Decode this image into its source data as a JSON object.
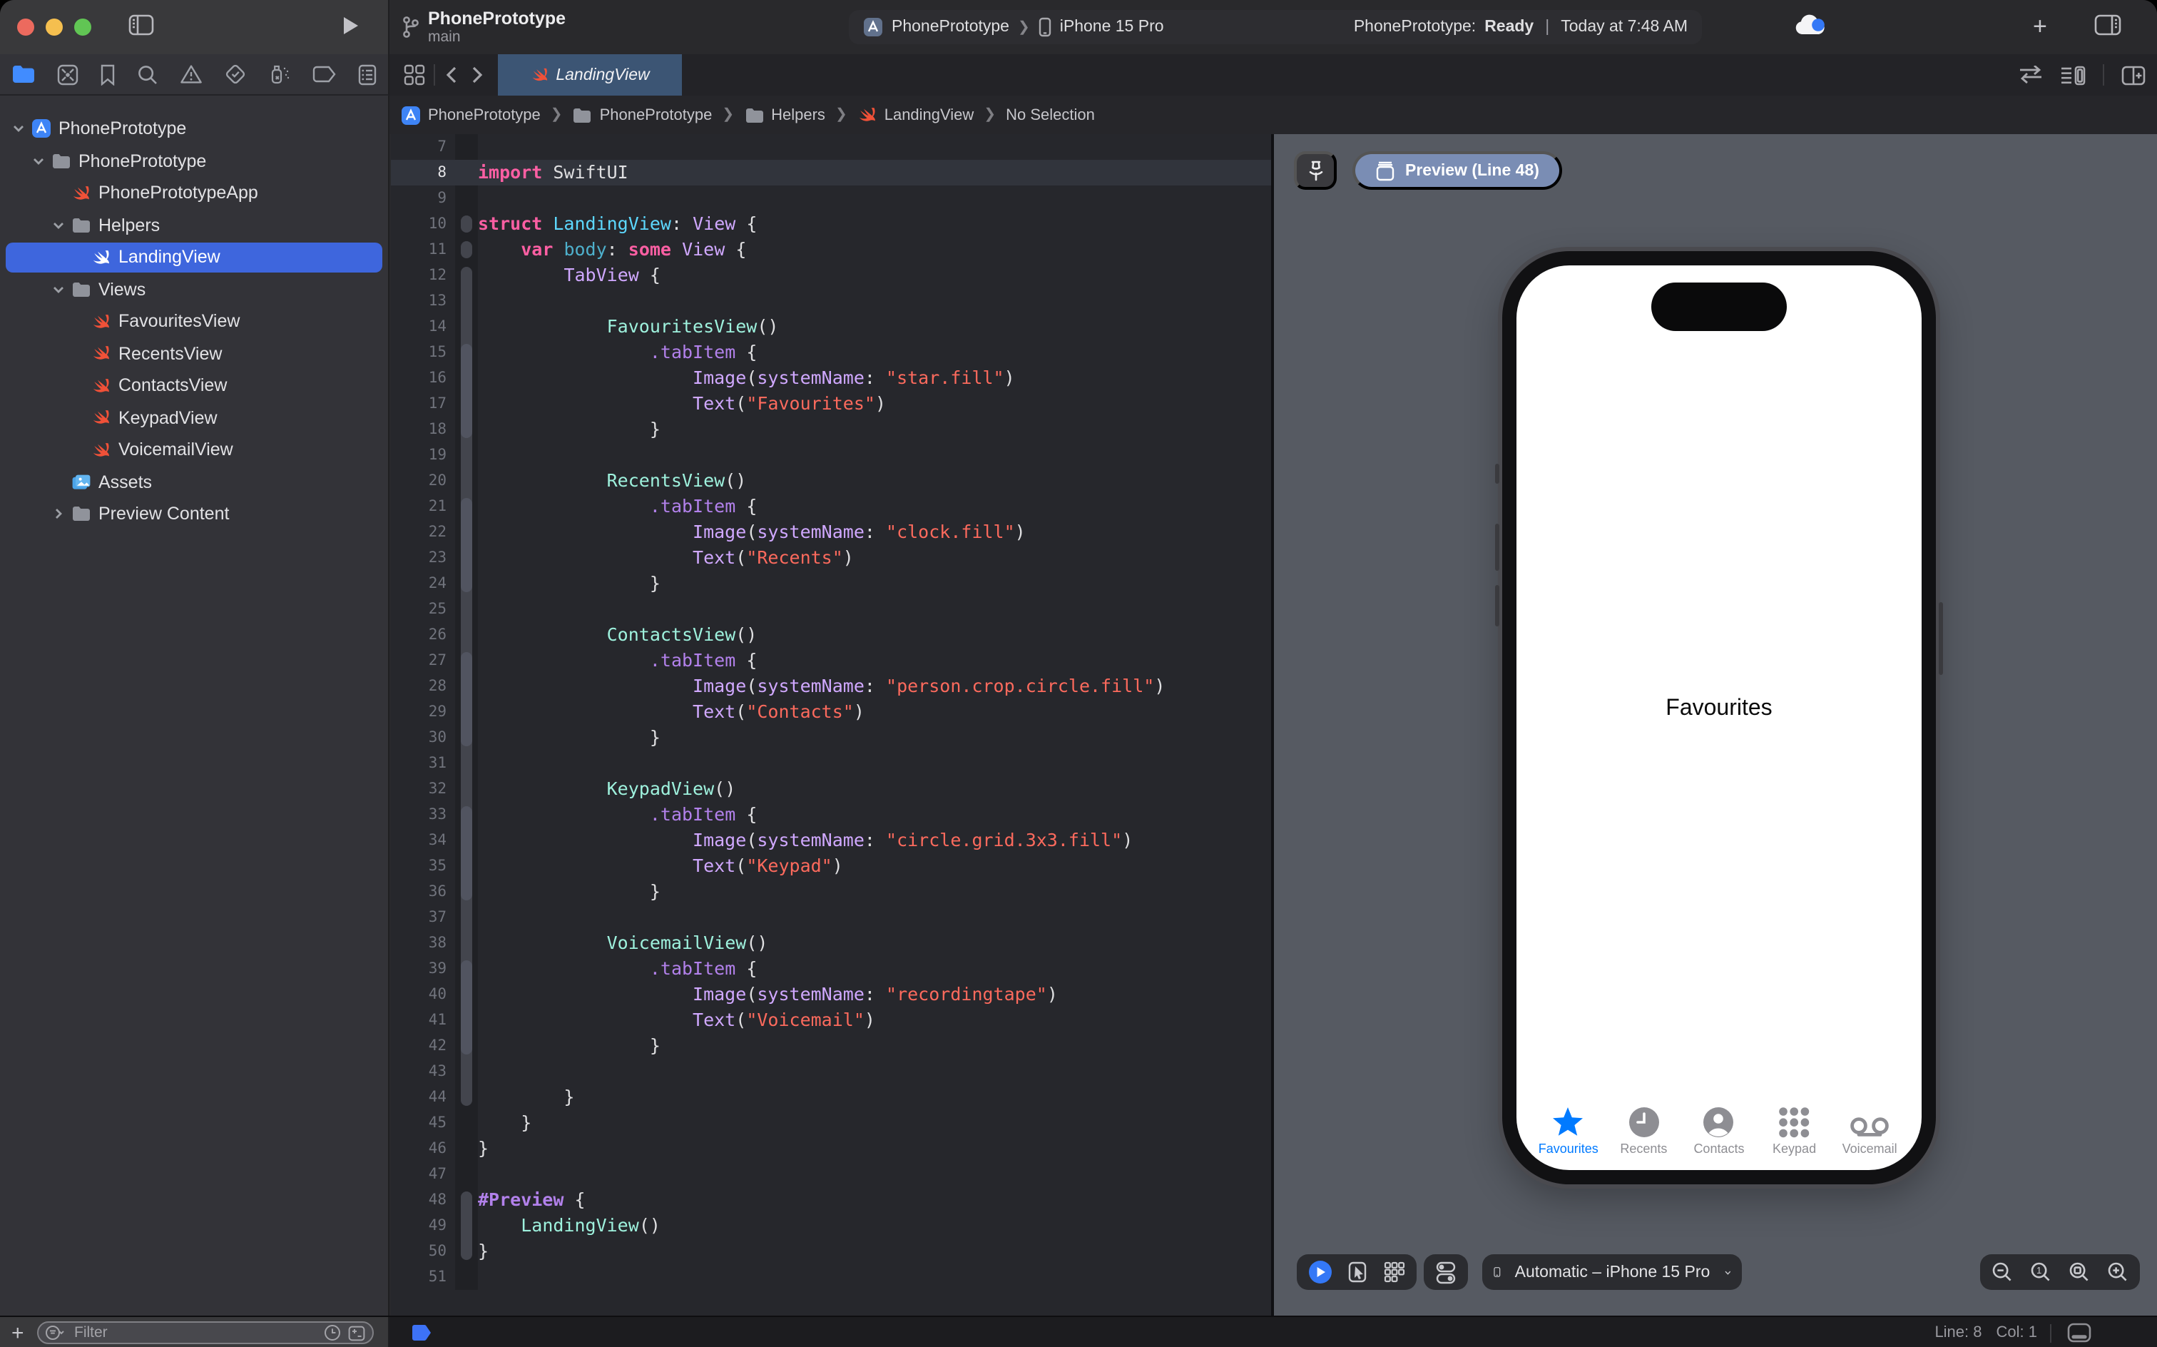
{
  "toolbar": {
    "window_title": "PhonePrototype",
    "branch": "main",
    "scheme": {
      "project": "PhonePrototype",
      "destination": "iPhone 15 Pro"
    },
    "status": {
      "project": "PhonePrototype:",
      "state": "Ready",
      "separator": "|",
      "time": "Today at 7:48 AM"
    },
    "add_label": "+"
  },
  "navigator": {
    "filter_placeholder": "Filter",
    "files": [
      {
        "label": "PhonePrototype",
        "depth": 0,
        "icon": "project",
        "disclosure": "open"
      },
      {
        "label": "PhonePrototype",
        "depth": 1,
        "icon": "folder",
        "disclosure": "open"
      },
      {
        "label": "PhonePrototypeApp",
        "depth": 2,
        "icon": "swift"
      },
      {
        "label": "Helpers",
        "depth": 2,
        "icon": "folder",
        "disclosure": "open"
      },
      {
        "label": "LandingView",
        "depth": 3,
        "icon": "swift",
        "selected": true
      },
      {
        "label": "Views",
        "depth": 2,
        "icon": "folder",
        "disclosure": "open"
      },
      {
        "label": "FavouritesView",
        "depth": 3,
        "icon": "swift"
      },
      {
        "label": "RecentsView",
        "depth": 3,
        "icon": "swift"
      },
      {
        "label": "ContactsView",
        "depth": 3,
        "icon": "swift"
      },
      {
        "label": "KeypadView",
        "depth": 3,
        "icon": "swift"
      },
      {
        "label": "VoicemailView",
        "depth": 3,
        "icon": "swift"
      },
      {
        "label": "Assets",
        "depth": 2,
        "icon": "assets"
      },
      {
        "label": "Preview Content",
        "depth": 2,
        "icon": "folder",
        "disclosure": "closed"
      }
    ]
  },
  "editor": {
    "tab_label": "LandingView",
    "breadcrumbs": [
      {
        "label": "PhonePrototype",
        "icon": "project"
      },
      {
        "label": "PhonePrototype",
        "icon": "folder"
      },
      {
        "label": "Helpers",
        "icon": "folder"
      },
      {
        "label": "LandingView",
        "icon": "swift"
      },
      {
        "label": "No Selection",
        "icon": "none"
      }
    ],
    "current_line": 8,
    "fold_ranges": [
      [
        10,
        10
      ],
      [
        11,
        11
      ],
      [
        12,
        44
      ],
      [
        48,
        50
      ]
    ],
    "fold_ranges_inner": [
      [
        15,
        18
      ],
      [
        21,
        24
      ],
      [
        27,
        30
      ],
      [
        33,
        36
      ],
      [
        39,
        42
      ]
    ],
    "lines": [
      {
        "n": 7,
        "t": []
      },
      {
        "n": 8,
        "t": [
          [
            "k",
            "import"
          ],
          [
            "p",
            " SwiftUI"
          ]
        ]
      },
      {
        "n": 9,
        "t": []
      },
      {
        "n": 10,
        "t": [
          [
            "k",
            "struct"
          ],
          [
            "p",
            " "
          ],
          [
            "td",
            "LandingView"
          ],
          [
            "p",
            ": "
          ],
          [
            "cl",
            "View"
          ],
          [
            "p",
            " {"
          ]
        ]
      },
      {
        "n": 11,
        "t": [
          [
            "p",
            "    "
          ],
          [
            "k",
            "var"
          ],
          [
            "p",
            " "
          ],
          [
            "pr",
            "body"
          ],
          [
            "p",
            ": "
          ],
          [
            "k",
            "some"
          ],
          [
            "p",
            " "
          ],
          [
            "cl",
            "View"
          ],
          [
            "p",
            " {"
          ]
        ]
      },
      {
        "n": 12,
        "t": [
          [
            "p",
            "        "
          ],
          [
            "cl",
            "TabView"
          ],
          [
            "p",
            " {"
          ]
        ]
      },
      {
        "n": 13,
        "t": []
      },
      {
        "n": 14,
        "t": [
          [
            "p",
            "            "
          ],
          [
            "pt",
            "FavouritesView"
          ],
          [
            "p",
            "()"
          ]
        ]
      },
      {
        "n": 15,
        "t": [
          [
            "p",
            "                "
          ],
          [
            "fn",
            ".tabItem"
          ],
          [
            "p",
            " {"
          ]
        ]
      },
      {
        "n": 16,
        "t": [
          [
            "p",
            "                    "
          ],
          [
            "cl",
            "Image"
          ],
          [
            "p",
            "("
          ],
          [
            "cl",
            "systemName"
          ],
          [
            "p",
            ": "
          ],
          [
            "s",
            "\"star.fill\""
          ],
          [
            "p",
            ")"
          ]
        ]
      },
      {
        "n": 17,
        "t": [
          [
            "p",
            "                    "
          ],
          [
            "cl",
            "Text"
          ],
          [
            "p",
            "("
          ],
          [
            "s",
            "\"Favourites\""
          ],
          [
            "p",
            ")"
          ]
        ]
      },
      {
        "n": 18,
        "t": [
          [
            "p",
            "                }"
          ]
        ]
      },
      {
        "n": 19,
        "t": []
      },
      {
        "n": 20,
        "t": [
          [
            "p",
            "            "
          ],
          [
            "pt",
            "RecentsView"
          ],
          [
            "p",
            "()"
          ]
        ]
      },
      {
        "n": 21,
        "t": [
          [
            "p",
            "                "
          ],
          [
            "fn",
            ".tabItem"
          ],
          [
            "p",
            " {"
          ]
        ]
      },
      {
        "n": 22,
        "t": [
          [
            "p",
            "                    "
          ],
          [
            "cl",
            "Image"
          ],
          [
            "p",
            "("
          ],
          [
            "cl",
            "systemName"
          ],
          [
            "p",
            ": "
          ],
          [
            "s",
            "\"clock.fill\""
          ],
          [
            "p",
            ")"
          ]
        ]
      },
      {
        "n": 23,
        "t": [
          [
            "p",
            "                    "
          ],
          [
            "cl",
            "Text"
          ],
          [
            "p",
            "("
          ],
          [
            "s",
            "\"Recents\""
          ],
          [
            "p",
            ")"
          ]
        ]
      },
      {
        "n": 24,
        "t": [
          [
            "p",
            "                }"
          ]
        ]
      },
      {
        "n": 25,
        "t": []
      },
      {
        "n": 26,
        "t": [
          [
            "p",
            "            "
          ],
          [
            "pt",
            "ContactsView"
          ],
          [
            "p",
            "()"
          ]
        ]
      },
      {
        "n": 27,
        "t": [
          [
            "p",
            "                "
          ],
          [
            "fn",
            ".tabItem"
          ],
          [
            "p",
            " {"
          ]
        ]
      },
      {
        "n": 28,
        "t": [
          [
            "p",
            "                    "
          ],
          [
            "cl",
            "Image"
          ],
          [
            "p",
            "("
          ],
          [
            "cl",
            "systemName"
          ],
          [
            "p",
            ": "
          ],
          [
            "s",
            "\"person.crop.circle.fill\""
          ],
          [
            "p",
            ")"
          ]
        ]
      },
      {
        "n": 29,
        "t": [
          [
            "p",
            "                    "
          ],
          [
            "cl",
            "Text"
          ],
          [
            "p",
            "("
          ],
          [
            "s",
            "\"Contacts\""
          ],
          [
            "p",
            ")"
          ]
        ]
      },
      {
        "n": 30,
        "t": [
          [
            "p",
            "                }"
          ]
        ]
      },
      {
        "n": 31,
        "t": []
      },
      {
        "n": 32,
        "t": [
          [
            "p",
            "            "
          ],
          [
            "pt",
            "KeypadView"
          ],
          [
            "p",
            "()"
          ]
        ]
      },
      {
        "n": 33,
        "t": [
          [
            "p",
            "                "
          ],
          [
            "fn",
            ".tabItem"
          ],
          [
            "p",
            " {"
          ]
        ]
      },
      {
        "n": 34,
        "t": [
          [
            "p",
            "                    "
          ],
          [
            "cl",
            "Image"
          ],
          [
            "p",
            "("
          ],
          [
            "cl",
            "systemName"
          ],
          [
            "p",
            ": "
          ],
          [
            "s",
            "\"circle.grid.3x3.fill\""
          ],
          [
            "p",
            ")"
          ]
        ]
      },
      {
        "n": 35,
        "t": [
          [
            "p",
            "                    "
          ],
          [
            "cl",
            "Text"
          ],
          [
            "p",
            "("
          ],
          [
            "s",
            "\"Keypad\""
          ],
          [
            "p",
            ")"
          ]
        ]
      },
      {
        "n": 36,
        "t": [
          [
            "p",
            "                }"
          ]
        ]
      },
      {
        "n": 37,
        "t": []
      },
      {
        "n": 38,
        "t": [
          [
            "p",
            "            "
          ],
          [
            "pt",
            "VoicemailView"
          ],
          [
            "p",
            "()"
          ]
        ]
      },
      {
        "n": 39,
        "t": [
          [
            "p",
            "                "
          ],
          [
            "fn",
            ".tabItem"
          ],
          [
            "p",
            " {"
          ]
        ]
      },
      {
        "n": 40,
        "t": [
          [
            "p",
            "                    "
          ],
          [
            "cl",
            "Image"
          ],
          [
            "p",
            "("
          ],
          [
            "cl",
            "systemName"
          ],
          [
            "p",
            ": "
          ],
          [
            "s",
            "\"recordingtape\""
          ],
          [
            "p",
            ")"
          ]
        ]
      },
      {
        "n": 41,
        "t": [
          [
            "p",
            "                    "
          ],
          [
            "cl",
            "Text"
          ],
          [
            "p",
            "("
          ],
          [
            "s",
            "\"Voicemail\""
          ],
          [
            "p",
            ")"
          ]
        ]
      },
      {
        "n": 42,
        "t": [
          [
            "p",
            "                }"
          ]
        ]
      },
      {
        "n": 43,
        "t": []
      },
      {
        "n": 44,
        "t": [
          [
            "p",
            "        }"
          ]
        ]
      },
      {
        "n": 45,
        "t": [
          [
            "p",
            "    }"
          ]
        ]
      },
      {
        "n": 46,
        "t": [
          [
            "p",
            "}"
          ]
        ]
      },
      {
        "n": 47,
        "t": []
      },
      {
        "n": 48,
        "t": [
          [
            "dr",
            "#Preview"
          ],
          [
            "p",
            " {"
          ]
        ]
      },
      {
        "n": 49,
        "t": [
          [
            "p",
            "    "
          ],
          [
            "pt",
            "LandingView"
          ],
          [
            "p",
            "()"
          ]
        ]
      },
      {
        "n": 50,
        "t": [
          [
            "p",
            "}"
          ]
        ]
      },
      {
        "n": 51,
        "t": []
      }
    ]
  },
  "preview": {
    "preview_button_label": "Preview (Line 48)",
    "device_selector": "Automatic – iPhone 15 Pro",
    "phone": {
      "content_label": "Favourites",
      "accent_color": "#007AFF",
      "inactive_color": "#8E8E93",
      "tabbar": [
        {
          "label": "Favourites",
          "icon": "star",
          "active": true
        },
        {
          "label": "Recents",
          "icon": "clock"
        },
        {
          "label": "Contacts",
          "icon": "person"
        },
        {
          "label": "Keypad",
          "icon": "keypad"
        },
        {
          "label": "Voicemail",
          "icon": "voicemail"
        }
      ]
    }
  },
  "statusbar": {
    "line": "Line: 8",
    "col": "Col: 1"
  }
}
